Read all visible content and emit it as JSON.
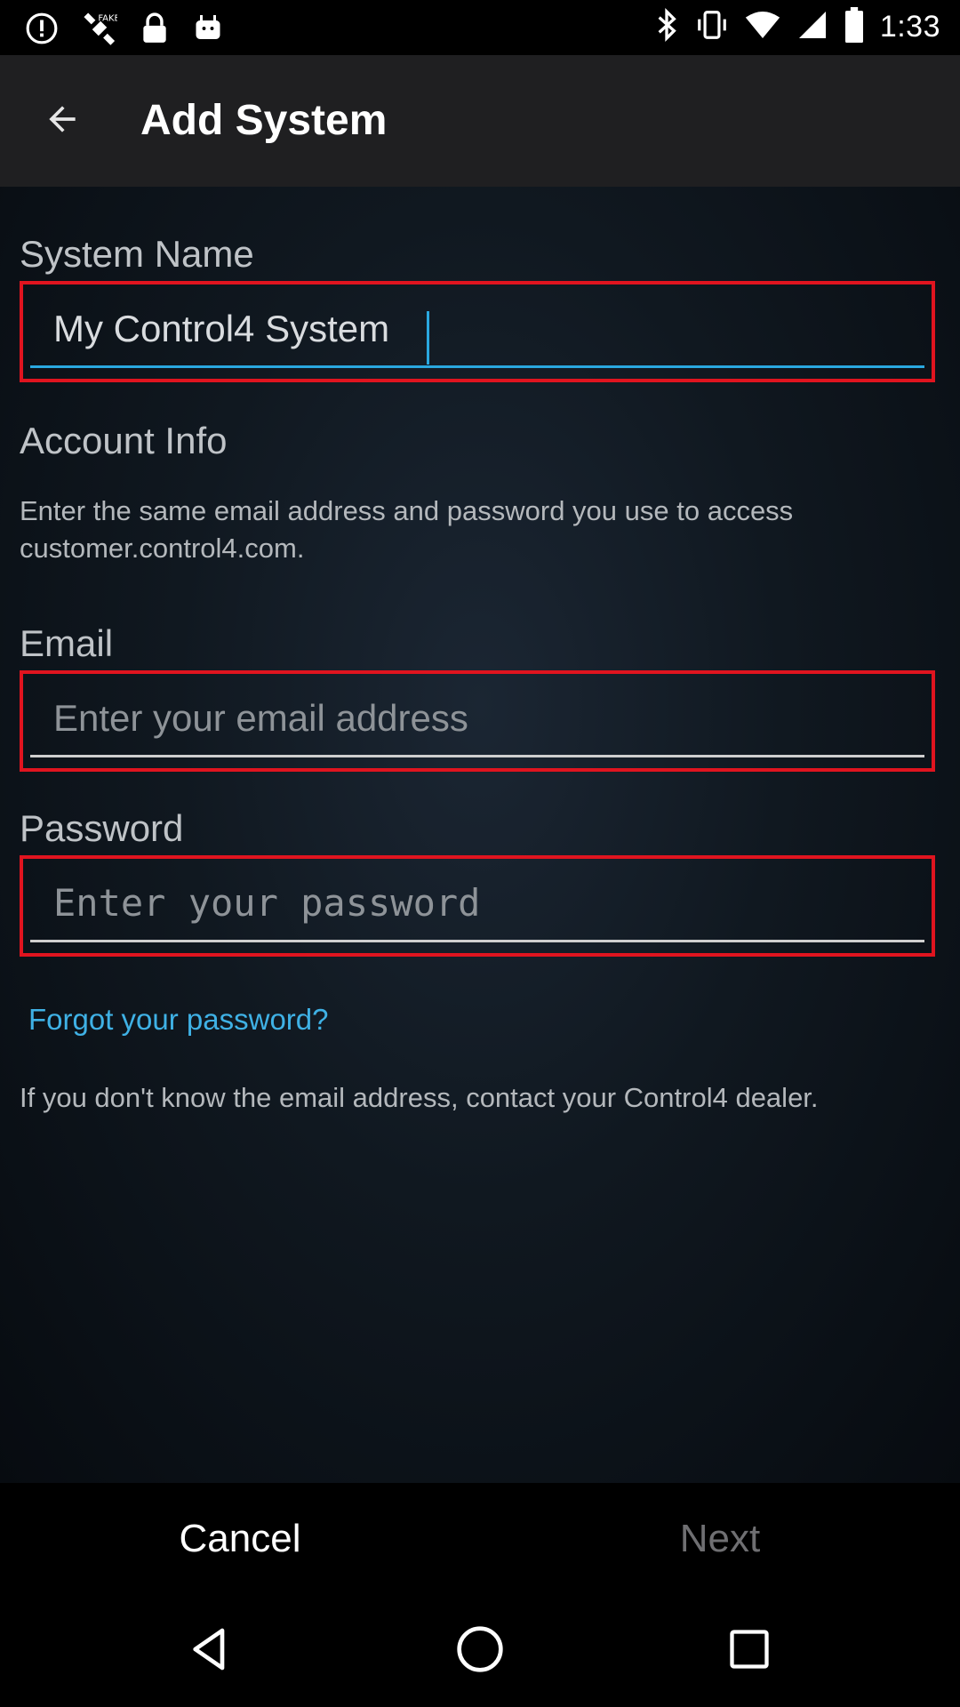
{
  "status_bar": {
    "time": "1:33",
    "left_icons": [
      "alert-circle-icon",
      "satellite-icon",
      "lock-icon",
      "android-icon"
    ],
    "right_icons": [
      "bluetooth-icon",
      "vibrate-icon",
      "wifi-icon",
      "signal-icon",
      "battery-icon"
    ]
  },
  "app_bar": {
    "title": "Add System",
    "back_icon": "arrow-back-icon"
  },
  "system_name": {
    "label": "System Name",
    "value": "My Control4 System"
  },
  "account_info": {
    "heading": "Account Info",
    "description": "Enter the same email address and password you use to access customer.control4.com."
  },
  "email": {
    "label": "Email",
    "value": "",
    "placeholder": "Enter your email address"
  },
  "password": {
    "label": "Password",
    "value": "",
    "placeholder": "Enter your password"
  },
  "forgot_link": "Forgot your password?",
  "dealer_note": "If you don't know the email address, contact your Control4 dealer.",
  "buttons": {
    "cancel": "Cancel",
    "next": "Next"
  },
  "colors": {
    "accent": "#2aa8e0",
    "highlight_border": "#e0141f",
    "link": "#3fb1e5",
    "disabled": "#6f6f72"
  }
}
